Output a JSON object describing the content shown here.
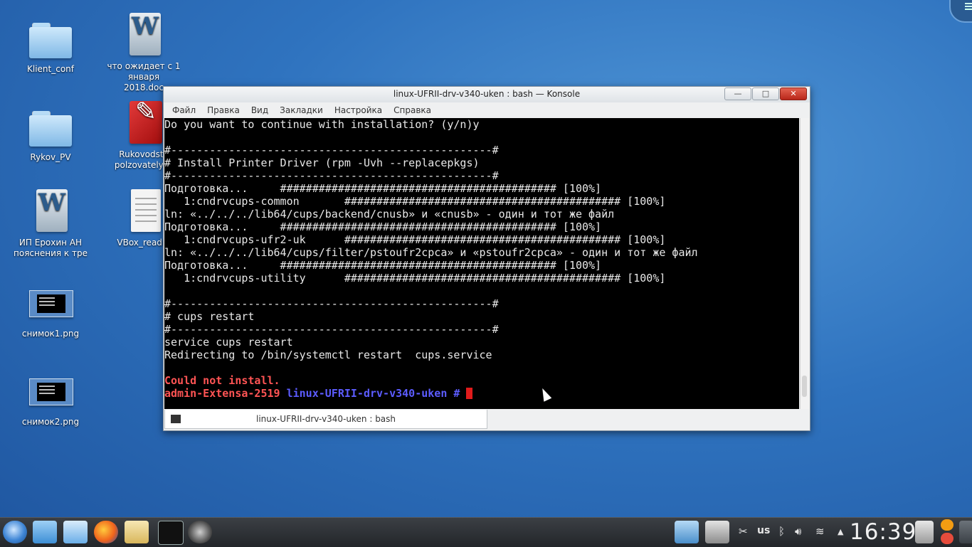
{
  "desktop": {
    "icons": [
      {
        "label": "Klient_conf"
      },
      {
        "label": "что ожидает с 1 января 2018.doc"
      },
      {
        "label": "Rykov_PV"
      },
      {
        "label": "Rukovodstv polzovatelya_"
      },
      {
        "label": "ИП Ерохин АН пояснения к тре"
      },
      {
        "label": "VBox_readm"
      },
      {
        "label": "снимок1.png"
      },
      {
        "label": "снимок2.png"
      }
    ]
  },
  "window": {
    "title": "linux-UFRII-drv-v340-uken : bash — Konsole",
    "menu": [
      "Файл",
      "Правка",
      "Вид",
      "Закладки",
      "Настройка",
      "Справка"
    ],
    "tab_label": "linux-UFRII-drv-v340-uken : bash"
  },
  "terminal": {
    "lines": [
      "Do you want to continue with installation? (y/n)y",
      "",
      "#--------------------------------------------------#",
      "# Install Printer Driver (rpm -Uvh --replacepkgs)",
      "#--------------------------------------------------#",
      "Подготовка...     ########################################### [100%]",
      "   1:cndrvcups-common       ########################################### [100%]",
      "ln: «../../../lib64/cups/backend/cnusb» и «cnusb» - один и тот же файл",
      "Подготовка...     ########################################### [100%]",
      "   1:cndrvcups-ufr2-uk      ########################################### [100%]",
      "ln: «../../../lib64/cups/filter/pstoufr2cpca» и «pstoufr2cpca» - один и тот же файл",
      "Подготовка...     ########################################### [100%]",
      "   1:cndrvcups-utility      ########################################### [100%]",
      "",
      "#--------------------------------------------------#",
      "# cups restart",
      "#--------------------------------------------------#",
      "service cups restart",
      "Redirecting to /bin/systemctl restart  cups.service",
      ""
    ],
    "error": "Could not install.",
    "prompt_user": "admin-Extensa-2519",
    "prompt_dir": "linux-UFRII-drv-v340-uken #"
  },
  "taskbar": {
    "keyboard_layout": "us",
    "clock": "16:39"
  },
  "colors": {
    "error_red": "#ff5454",
    "prompt_blue": "#5c5cff",
    "cursor_red": "#e01b1b",
    "close_red": "#c0392b"
  }
}
